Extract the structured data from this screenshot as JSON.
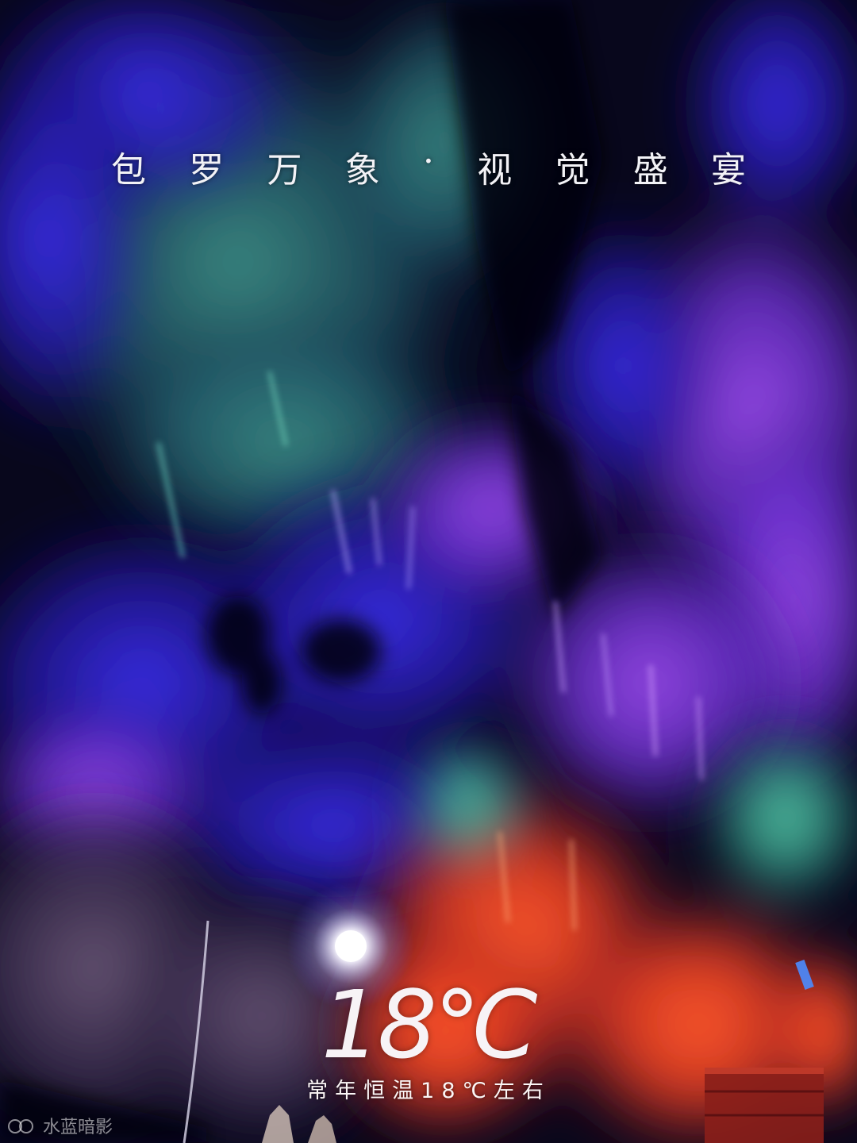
{
  "photo": {
    "subject": "illuminated karst cave",
    "palette": {
      "deep_blue": "#2a1fb8",
      "violet": "#6a2fd6",
      "teal": "#2f7f8a",
      "green": "#3fae8c",
      "red_orange": "#e0402a",
      "shadow": "#07061a",
      "lamp": "#ffffff"
    }
  },
  "headline": {
    "chars": [
      "包",
      "罗",
      "万",
      "象",
      "·",
      "视",
      "觉",
      "盛",
      "宴"
    ]
  },
  "temperature": {
    "big": "18℃",
    "caption": "常年恒温18℃左右"
  },
  "watermark": {
    "text": "水蓝暗影",
    "icon": "link-rings-icon"
  }
}
